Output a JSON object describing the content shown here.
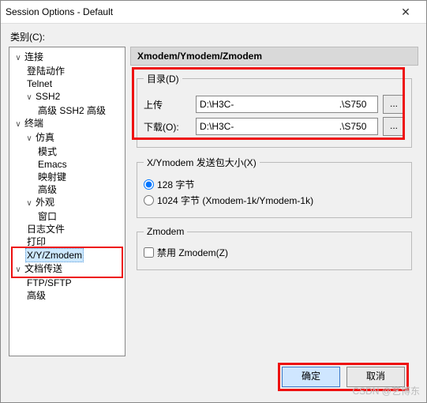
{
  "window": {
    "title": "Session Options - Default",
    "close_glyph": "✕"
  },
  "category_label": "类别(C):",
  "tree": {
    "connection": "连接",
    "login_actions": "登陆动作",
    "telnet": "Telnet",
    "ssh2": "SSH2",
    "ssh2_advanced": "高级 SSH2 高级",
    "terminal": "终端",
    "emulation": "仿真",
    "modes": "模式",
    "emacs": "Emacs",
    "mapped_keys": "映射键",
    "advanced": "高级",
    "appearance": "外观",
    "window": "窗口",
    "log_file": "日志文件",
    "printing": "打印",
    "xyzmodem": "X/Y/Zmodem",
    "file_transfer": "文档传送",
    "ftp_sftp": "FTP/SFTP",
    "advanced2": "高级"
  },
  "panel": {
    "title": "Xmodem/Ymodem/Zmodem",
    "dir_legend": "目录(D)",
    "upload_label": "上传",
    "download_label": "下载(O):",
    "upload_value": "D:\\H3C-                                        .\\S750",
    "download_value": "D:\\H3C-                                        .\\S750",
    "browse_glyph": "...",
    "packet_legend": "X/Ymodem 发送包大小(X)",
    "opt_128": "128 字节",
    "opt_1024": "1024 字节  (Xmodem-1k/Ymodem-1k)",
    "zmodem_legend": "Zmodem",
    "disable_zmodem": "禁用 Zmodem(Z)"
  },
  "buttons": {
    "ok": "确定",
    "cancel": "取消"
  },
  "watermark": "CSDN @艺博东"
}
